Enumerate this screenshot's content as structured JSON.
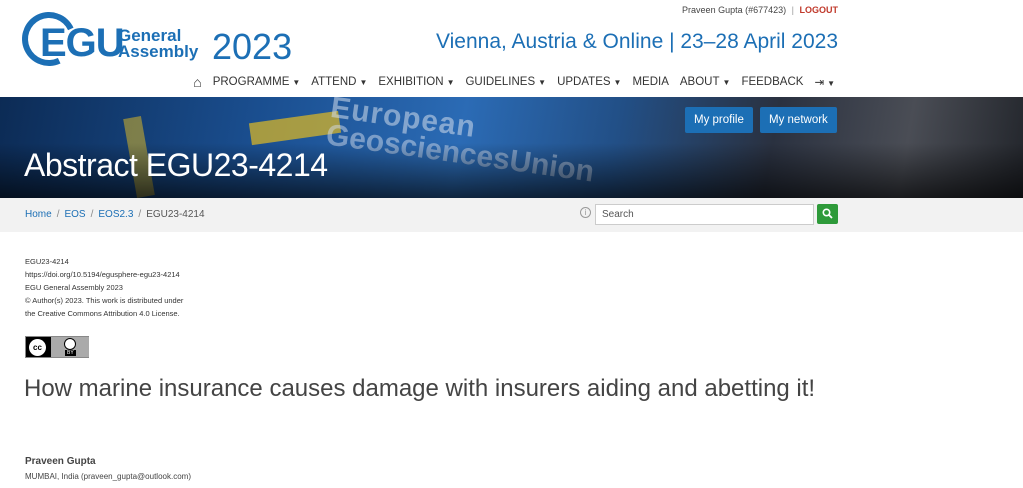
{
  "topbar": {
    "user": "Praveen Gupta (#677423)",
    "separator": "|",
    "logout": "LOGOUT"
  },
  "logo": {
    "abbr": "EGU",
    "line1": "General",
    "line2": "Assembly",
    "year": "2023"
  },
  "venue": "Vienna, Austria & Online | 23–28 April 2023",
  "nav": {
    "items": [
      {
        "label": "PROGRAMME",
        "dropdown": true
      },
      {
        "label": "ATTEND",
        "dropdown": true
      },
      {
        "label": "EXHIBITION",
        "dropdown": true
      },
      {
        "label": "GUIDELINES",
        "dropdown": true
      },
      {
        "label": "UPDATES",
        "dropdown": true
      },
      {
        "label": "MEDIA",
        "dropdown": false
      },
      {
        "label": "ABOUT",
        "dropdown": true
      },
      {
        "label": "FEEDBACK",
        "dropdown": false
      }
    ]
  },
  "banner": {
    "title": "Abstract EGU23-4214",
    "flag_text1": "European",
    "flag_text2": "GeosciencesUnion",
    "profile_btn": "My profile",
    "network_btn": "My network"
  },
  "breadcrumb": {
    "home": "Home",
    "eos": "EOS",
    "eos23": "EOS2.3",
    "current": "EGU23-4214"
  },
  "search": {
    "placeholder": "Search"
  },
  "meta": {
    "id": "EGU23-4214",
    "doi": "https://doi.org/10.5194/egusphere-egu23-4214",
    "conf": "EGU General Assembly 2023",
    "copyright": "© Author(s) 2023. This work is distributed under",
    "license": "the Creative Commons Attribution 4.0 License."
  },
  "license_badge": {
    "cc": "cc",
    "by": "BY"
  },
  "abstract": {
    "title": "How marine insurance causes damage with insurers aiding and abetting it!",
    "author": "Praveen Gupta",
    "affiliation": "MUMBAI, India (praveen_gupta@outlook.com)"
  }
}
